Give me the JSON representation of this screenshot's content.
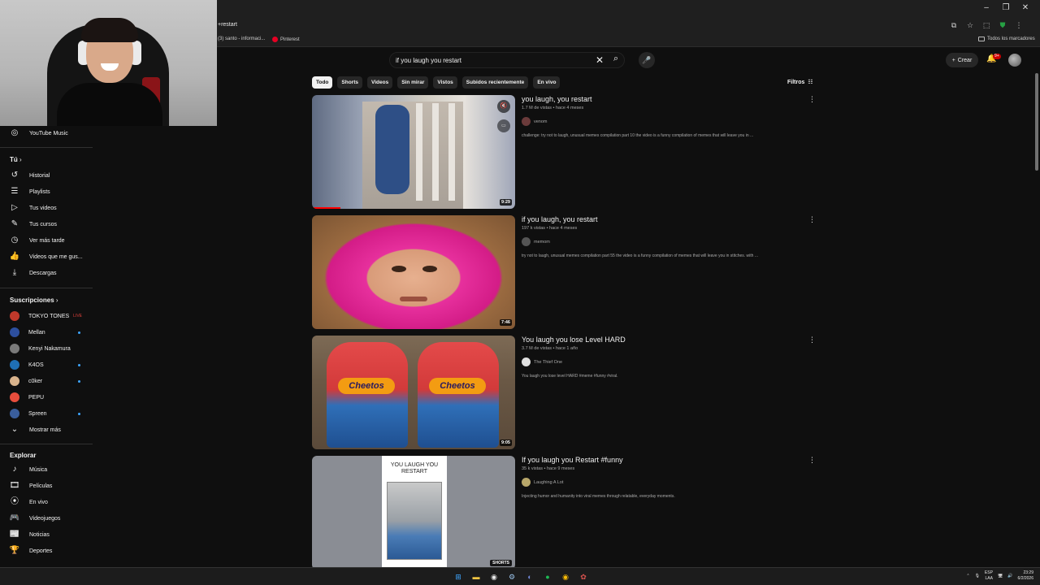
{
  "browser": {
    "address_text": "+restart",
    "window_buttons": [
      "–",
      "❐",
      "✕"
    ],
    "bookmarks": [
      {
        "label": "(3) santo - informaci...",
        "icon": "tab-icon"
      },
      {
        "label": "Pinterest",
        "icon": "pinterest-icon"
      }
    ],
    "all_bookmarks_label": "Todos los marcadores"
  },
  "sidebar": {
    "music_label": "YouTube Music",
    "you_heading": "Tú",
    "you_items": [
      {
        "label": "Historial",
        "icon": "history-icon",
        "glyph": "↺"
      },
      {
        "label": "Playlists",
        "icon": "playlists-icon",
        "glyph": "☰"
      },
      {
        "label": "Tus videos",
        "icon": "your-videos-icon",
        "glyph": "▷"
      },
      {
        "label": "Tus cursos",
        "icon": "courses-icon",
        "glyph": "✎"
      },
      {
        "label": "Ver más tarde",
        "icon": "watch-later-icon",
        "glyph": "◷"
      },
      {
        "label": "Videos que me gus...",
        "icon": "liked-icon",
        "glyph": "👍"
      },
      {
        "label": "Descargas",
        "icon": "downloads-icon",
        "glyph": "⤓"
      }
    ],
    "subs_heading": "Suscripciones",
    "subscriptions": [
      {
        "label": "TOKYO TONES",
        "color": "#c0392b",
        "live": "LIVE"
      },
      {
        "label": "Mellan",
        "color": "#2d4f9e",
        "dot": true
      },
      {
        "label": "Kenyi Nakamura",
        "color": "#7a7a7a"
      },
      {
        "label": "K4OS",
        "color": "#1f6fb4",
        "dot": true
      },
      {
        "label": "c0ker",
        "color": "#d9b38c",
        "dot": true
      },
      {
        "label": "PEPU",
        "color": "#e84d3c"
      },
      {
        "label": "Spreen",
        "color": "#3a5e9c",
        "dot": true
      }
    ],
    "show_more_label": "Mostrar más",
    "explore_heading": "Explorar",
    "explore_items": [
      {
        "label": "Música",
        "icon": "music-icon",
        "glyph": "♪"
      },
      {
        "label": "Películas",
        "icon": "movies-icon",
        "glyph": "🎞"
      },
      {
        "label": "En vivo",
        "icon": "live-icon",
        "glyph": "⦿"
      },
      {
        "label": "Videojuegos",
        "icon": "gaming-icon",
        "glyph": "🎮"
      },
      {
        "label": "Noticias",
        "icon": "news-icon",
        "glyph": "📰"
      },
      {
        "label": "Deportes",
        "icon": "sports-icon",
        "glyph": "🏆"
      }
    ]
  },
  "topbar": {
    "search_value": "if you laugh you restart",
    "create_label": "Crear",
    "notifications_badge": "9+"
  },
  "chips": [
    "Todo",
    "Shorts",
    "Videos",
    "Sin mirar",
    "Vistos",
    "Subidos recientemente",
    "En vivo"
  ],
  "active_chip": "Todo",
  "filters_label": "Filtros",
  "results": [
    {
      "title": "you laugh, you restart",
      "meta": "1.7 M de vistas • hace 4 meses",
      "channel": "venom",
      "channel_color": "#6b3b3b",
      "description": "challenge: try not to laugh, unusual memes compilation part 10 the video is a funny compilation of memes that will leave you in ...",
      "duration": "9:29"
    },
    {
      "title": "if you laugh, you restart",
      "meta": "197 k vistas • hace 4 meses",
      "channel": "memom",
      "channel_color": "#555555",
      "description": "try not to laugh, unusual memes compilation part 55 the video is a funny compilation of memes that will leave you in stitches. with ...",
      "duration": "7:46"
    },
    {
      "title": "You laugh you lose Level HARD",
      "meta": "3.7 M de vistas • hace 1 año",
      "channel": "The Thief One",
      "channel_color": "#e0e0e0",
      "description": "You laugh you lose level HARD #meme #funny #viral.",
      "duration": "9:05"
    },
    {
      "title": "If you laugh you Restart #funny",
      "meta": "35 k vistas • hace 9 meses",
      "channel": "Laughing A Lot",
      "channel_color": "#b8a76a",
      "description": "Injecting humor and humanity into viral memes through relatable, everyday moments.",
      "duration": "SHORTS",
      "card_title": "YOU LAUGH YOU RESTART"
    }
  ],
  "thumb3_logo": "Cheetos",
  "taskbar": {
    "lang": "ESP",
    "lang_sub": "LAA",
    "time": "23:29",
    "date": "6/2/2026"
  }
}
